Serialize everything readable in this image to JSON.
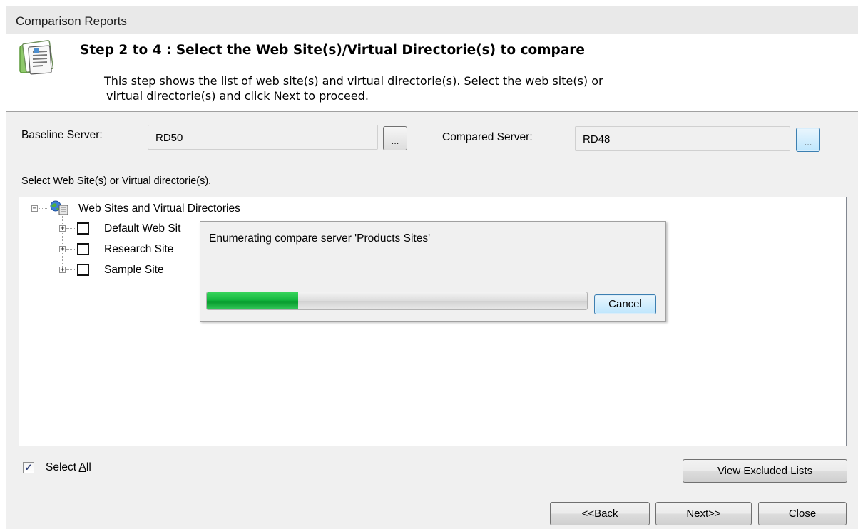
{
  "window": {
    "title": "Comparison Reports"
  },
  "header": {
    "step_title": "Step 2 to 4 : Select the Web Site(s)/Virtual Directorie(s) to compare",
    "description_line1": "This step shows the list of web site(s) and virtual directorie(s). Select the web site(s) or",
    "description_line2": "virtual directorie(s) and click Next to proceed.",
    "icon": "document-report-icon"
  },
  "servers": {
    "baseline_label": "Baseline Server:",
    "baseline_value": "RD50",
    "compared_label": "Compared Server:",
    "compared_value": "RD48",
    "browse_label": "..."
  },
  "tree": {
    "instruction": "Select Web Site(s) or Virtual directorie(s).",
    "root_label": "Web Sites and Virtual Directories",
    "root_icon": "web-sites-globe-icon",
    "items": [
      {
        "label": "Default Web Sit",
        "checked": false
      },
      {
        "label": "Research Site",
        "checked": false
      },
      {
        "label": "Sample Site",
        "checked": false
      }
    ]
  },
  "progress_dialog": {
    "message": "Enumerating compare server 'Products Sites'",
    "progress_percent": 24,
    "cancel_label": "Cancel",
    "fill_color": "#13b63d"
  },
  "footer": {
    "select_all": {
      "prefix": "Select ",
      "accel": "A",
      "suffix": "ll",
      "checked": true
    },
    "view_excluded_label": "View Excluded Lists",
    "back": {
      "prefix": "<<",
      "accel": "B",
      "suffix": "ack"
    },
    "next": {
      "prefix": "",
      "accel": "N",
      "suffix": "ext>>"
    },
    "close": {
      "prefix": "",
      "accel": "C",
      "suffix": "lose"
    }
  }
}
